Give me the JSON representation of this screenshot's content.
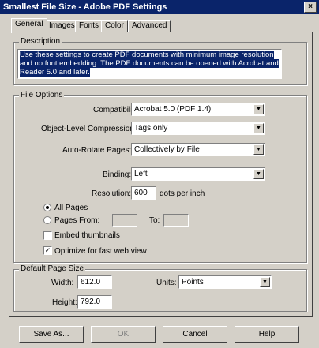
{
  "window": {
    "title": "Smallest File Size - Adobe PDF Settings",
    "close_glyph": "×"
  },
  "tabs": [
    {
      "label": "General",
      "active": true
    },
    {
      "label": "Images"
    },
    {
      "label": "Fonts"
    },
    {
      "label": "Color"
    },
    {
      "label": "Advanced"
    }
  ],
  "description": {
    "legend": "Description",
    "text": "Use these settings to create PDF documents with minimum image resolution and no font embedding. The PDF documents can be opened with Acrobat and Reader 5.0 and later."
  },
  "file_options": {
    "legend": "File Options",
    "compatibility": {
      "label": "Compatibility:",
      "value": "Acrobat 5.0 (PDF 1.4)"
    },
    "object_compression": {
      "label": "Object-Level Compression:",
      "value": "Tags only"
    },
    "auto_rotate": {
      "label": "Auto-Rotate Pages:",
      "value": "Collectively by File"
    },
    "binding": {
      "label": "Binding:",
      "value": "Left"
    },
    "resolution": {
      "label": "Resolution:",
      "value": "600",
      "unit": "dots per inch"
    },
    "all_pages": {
      "label": "All Pages",
      "checked": true
    },
    "pages_from": {
      "label": "Pages From:",
      "to_label": "To:",
      "from_value": "",
      "to_value": ""
    },
    "embed_thumbnails": {
      "label": "Embed thumbnails",
      "checked": false
    },
    "optimize_web": {
      "label": "Optimize for fast web view",
      "checked": true
    },
    "check_glyph": "✓"
  },
  "page_size": {
    "legend": "Default Page Size",
    "width": {
      "label": "Width:",
      "value": "612.0"
    },
    "units": {
      "label": "Units:",
      "value": "Points"
    },
    "height": {
      "label": "Height:",
      "value": "792.0"
    }
  },
  "buttons": {
    "save_as": "Save As...",
    "ok": "OK",
    "cancel": "Cancel",
    "help": "Help"
  },
  "arrow_glyph": "▼"
}
